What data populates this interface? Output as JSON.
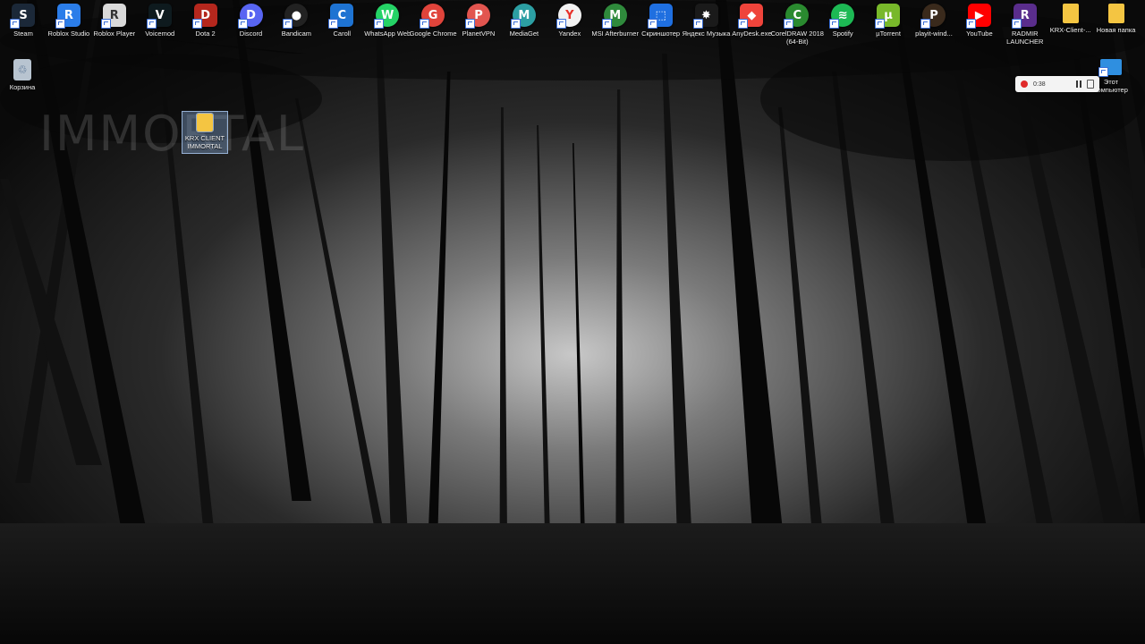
{
  "desktop": {
    "top_icons": [
      {
        "label": "Steam",
        "icon": "steam-icon",
        "color": "#1b2838",
        "glyph": "S"
      },
      {
        "label": "Roblox Studio",
        "icon": "roblox-studio-icon",
        "color": "#2b7de9",
        "glyph": "R"
      },
      {
        "label": "Roblox Player",
        "icon": "roblox-player-icon",
        "color": "#d9d9d9",
        "glyph": "R"
      },
      {
        "label": "Voicemod",
        "icon": "voicemod-icon",
        "color": "#0e1a1e",
        "glyph": "V"
      },
      {
        "label": "Dota 2",
        "icon": "dota2-icon",
        "color": "#b5271d",
        "glyph": "D"
      },
      {
        "label": "Discord",
        "icon": "discord-icon",
        "color": "#5865f2",
        "glyph": "D"
      },
      {
        "label": "Bandicam",
        "icon": "bandicam-icon",
        "color": "#222222",
        "glyph": "●"
      },
      {
        "label": "Caroll",
        "icon": "caroll-icon",
        "color": "#1e73d2",
        "glyph": "C"
      },
      {
        "label": "WhatsApp Web",
        "icon": "whatsapp-icon",
        "color": "#25d366",
        "glyph": "W"
      },
      {
        "label": "Google Chrome",
        "icon": "chrome-icon",
        "color": "#e0443b",
        "glyph": "G"
      },
      {
        "label": "PlanetVPN",
        "icon": "planetvpn-icon",
        "color": "#e2554f",
        "glyph": "P"
      },
      {
        "label": "MediaGet",
        "icon": "mediaget-icon",
        "color": "#2c9fa3",
        "glyph": "M"
      },
      {
        "label": "Yandex",
        "icon": "yandex-icon",
        "color": "#f2f2f2",
        "glyph": "Y"
      },
      {
        "label": "MSI Afterburner",
        "icon": "msi-afterburner-icon",
        "color": "#2f8a3c",
        "glyph": "M"
      },
      {
        "label": "Скриншотер",
        "icon": "screenshoter-icon",
        "color": "#1f6fe0",
        "glyph": "⬚"
      },
      {
        "label": "Яндекс Музыка",
        "icon": "yandex-music-icon",
        "color": "#1a1a1a",
        "glyph": "✸"
      },
      {
        "label": "AnyDesk.exe",
        "icon": "anydesk-icon",
        "color": "#ef443b",
        "glyph": "◆"
      },
      {
        "label": "CorelDRAW 2018 (64-Bit)",
        "icon": "coreldraw-icon",
        "color": "#2a8a2f",
        "glyph": "C"
      },
      {
        "label": "Spotify",
        "icon": "spotify-icon",
        "color": "#1db954",
        "glyph": "≋"
      },
      {
        "label": "µTorrent",
        "icon": "utorrent-icon",
        "color": "#78b82a",
        "glyph": "µ"
      },
      {
        "label": "playit-wind...",
        "icon": "playit-icon",
        "color": "#3a2a1c",
        "glyph": "P"
      },
      {
        "label": "YouTube",
        "icon": "youtube-icon",
        "color": "#ff0000",
        "glyph": "▶"
      },
      {
        "label": "RADMIR LAUNCHER",
        "icon": "radmir-launcher-icon",
        "color": "#5a2d8c",
        "glyph": "R"
      },
      {
        "label": "KRX-Client-...",
        "icon": "folder-icon",
        "color": "#f4c542",
        "glyph": ""
      },
      {
        "label": "Новая папка",
        "icon": "folder-icon",
        "color": "#f4c542",
        "glyph": ""
      }
    ],
    "recycle_bin": {
      "label": "Корзина",
      "icon": "recycle-bin-icon"
    },
    "this_pc": {
      "label": "Этот компьютер",
      "icon": "computer-icon"
    },
    "dragged_folder": {
      "label": "KRX CLIENT IMMORTAL",
      "icon": "folder-icon"
    },
    "watermark": "IMMORTAL"
  },
  "recorder": {
    "time": "0:38",
    "record_icon": "record-dot-icon",
    "pause_icon": "pause-icon",
    "stop_icon": "stop-icon"
  }
}
